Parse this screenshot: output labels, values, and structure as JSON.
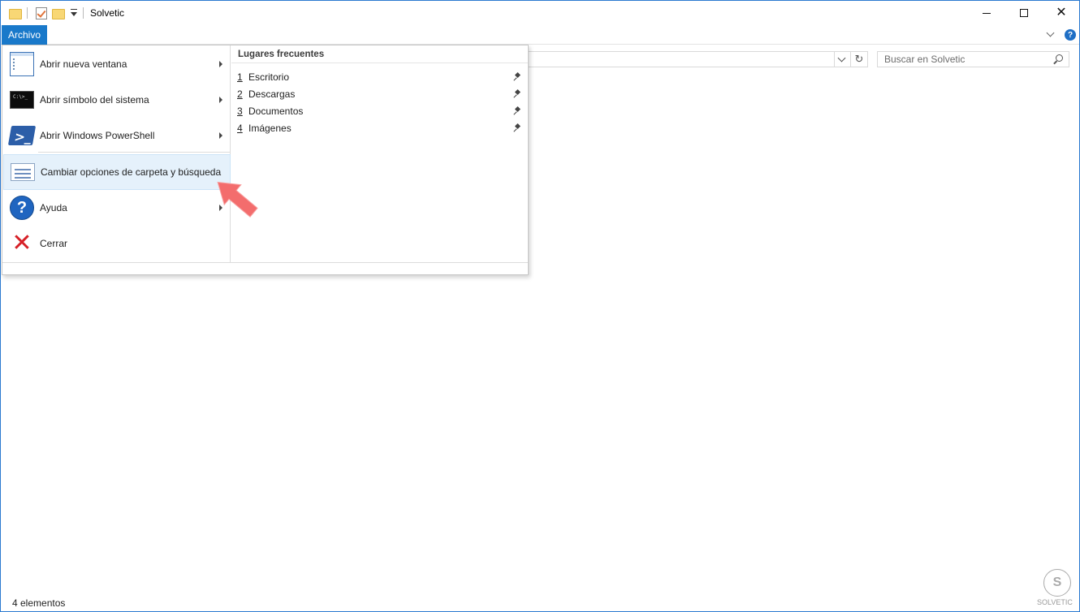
{
  "window": {
    "title": "Solvetic"
  },
  "ribbon": {
    "file_tab": "Archivo",
    "help_glyph": "?"
  },
  "search": {
    "placeholder": "Buscar en Solvetic"
  },
  "refresh_glyph": "↻",
  "file_menu": {
    "items": [
      {
        "label": "Abrir nueva ventana",
        "has_submenu": true,
        "icon": "new-window-icon"
      },
      {
        "label": "Abrir símbolo del sistema",
        "has_submenu": true,
        "icon": "command-prompt-icon"
      },
      {
        "label": "Abrir Windows PowerShell",
        "has_submenu": true,
        "icon": "powershell-icon"
      },
      {
        "label": "Cambiar opciones de carpeta y búsqueda",
        "has_submenu": false,
        "icon": "folder-options-icon",
        "highlighted": true
      },
      {
        "label": "Ayuda",
        "has_submenu": true,
        "icon": "help-icon"
      },
      {
        "label": "Cerrar",
        "has_submenu": false,
        "icon": "close-red-icon"
      }
    ],
    "cmd_text": "C:\\>_",
    "ps_glyph": ">_",
    "help_glyph": "?",
    "close_glyph": "✕",
    "frequent": {
      "title": "Lugares frecuentes",
      "places": [
        {
          "num": "1",
          "name": "Escritorio"
        },
        {
          "num": "2",
          "name": "Descargas"
        },
        {
          "num": "3",
          "name": "Documentos"
        },
        {
          "num": "4",
          "name": "Imágenes"
        }
      ]
    }
  },
  "status": {
    "items_count": "4 elementos"
  },
  "watermark": {
    "glyph": "S",
    "text": "SOLVETIC"
  },
  "colors": {
    "accent": "#1979ca",
    "pointer": "#f36d6d",
    "close_red": "#d61f26"
  }
}
